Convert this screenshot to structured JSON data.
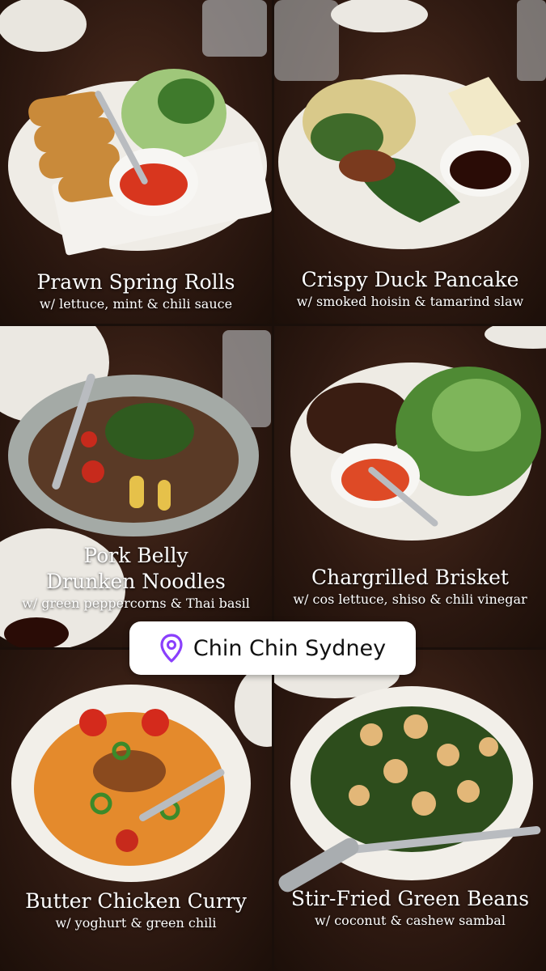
{
  "location": {
    "name": "Chin Chin Sydney",
    "icon": "location-pin-icon",
    "icon_color": "#8a3ffc"
  },
  "dishes": [
    {
      "title": "Prawn Spring Rolls",
      "subtitle": "w/ lettuce, mint & chili sauce"
    },
    {
      "title": "Crispy Duck Pancake",
      "subtitle": "w/ smoked hoisin & tamarind slaw"
    },
    {
      "title": "Pork Belly\nDrunken Noodles",
      "subtitle": "w/ green peppercorns & Thai basil"
    },
    {
      "title": "Chargrilled Brisket",
      "subtitle": "w/ cos lettuce, shiso & chili vinegar"
    },
    {
      "title": "Butter Chicken Curry",
      "subtitle": "w/ yoghurt & green chili"
    },
    {
      "title": "Stir-Fried Green Beans",
      "subtitle": "w/ coconut & cashew sambal"
    }
  ]
}
